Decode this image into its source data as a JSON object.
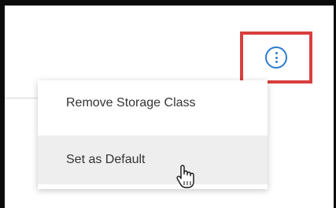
{
  "menu": {
    "items": [
      {
        "label": "Remove Storage Class"
      },
      {
        "label": "Set as Default"
      }
    ]
  },
  "icons": {
    "more": "more-options-vertical-icon",
    "cursor": "hand-pointer-cursor"
  },
  "colors": {
    "accent_blue": "#2b7bd0",
    "highlight_red": "#d93f3f",
    "hover_background": "#eeeeee",
    "text": "#333333"
  }
}
